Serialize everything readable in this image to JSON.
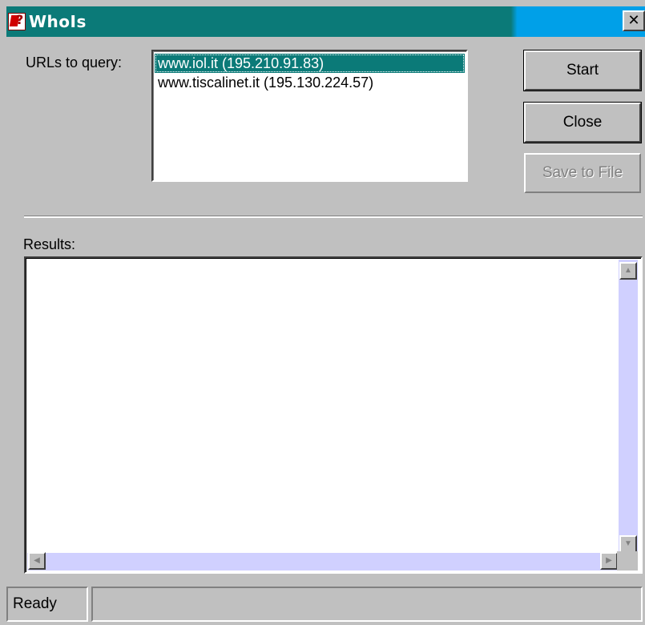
{
  "window": {
    "title": "WhoIs",
    "close_glyph": "✕",
    "icon": "whois-app-icon"
  },
  "urls": {
    "label": "URLs to query:",
    "items": [
      {
        "label": "www.iol.it (195.210.91.83)",
        "selected": true
      },
      {
        "label": "www.tiscalinet.it (195.130.224.57)",
        "selected": false
      }
    ]
  },
  "buttons": {
    "start": "Start",
    "close": "Close",
    "save": "Save to File"
  },
  "results": {
    "label": "Results:",
    "content": ""
  },
  "scroll": {
    "up": "▲",
    "down": "▼",
    "left": "◀",
    "right": "▶"
  },
  "status": {
    "text": "Ready",
    "message": ""
  },
  "colors": {
    "accent": "#0b7a78",
    "title_end": "#00a0e8",
    "scroll_track": "#d0d0ff",
    "face": "#c0c0c0"
  }
}
